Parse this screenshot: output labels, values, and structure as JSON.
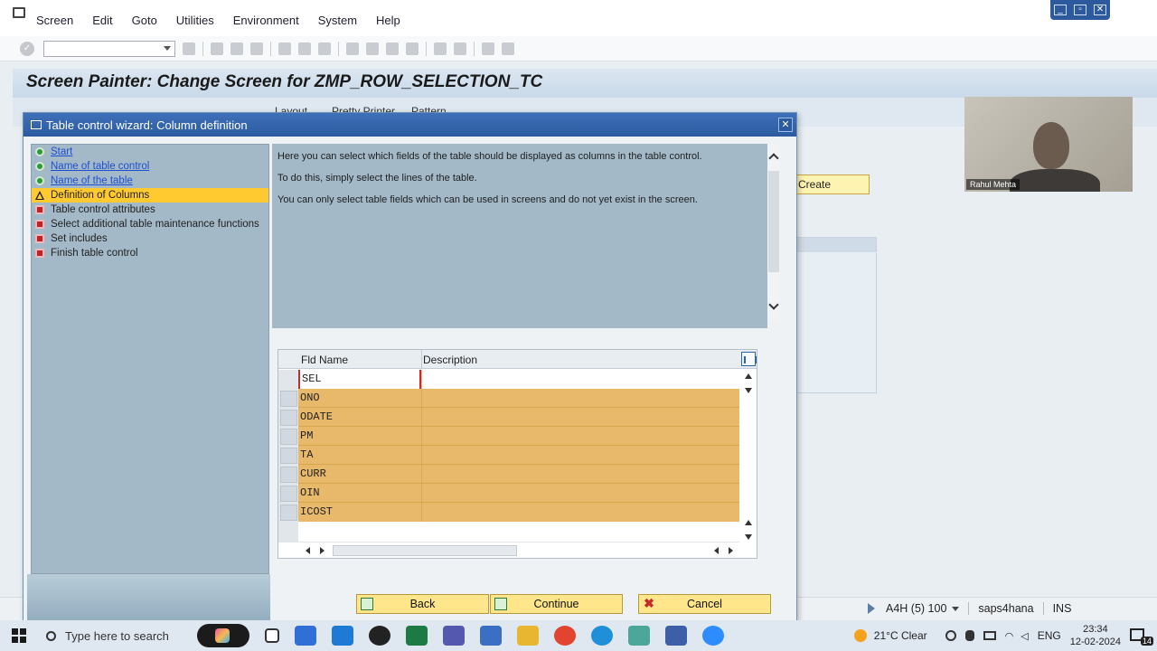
{
  "menu": [
    "Screen",
    "Edit",
    "Goto",
    "Utilities",
    "Environment",
    "System",
    "Help"
  ],
  "title": "Screen Painter: Change Screen for ZMP_ROW_SELECTION_TC",
  "subtoolbar": {
    "layout": "Layout",
    "pretty_printer": "Pretty Printer",
    "pattern": "Pattern"
  },
  "background": {
    "create_button": "Create"
  },
  "webcam": {
    "name": "Rahul Mehta"
  },
  "dialog": {
    "title": "Table control wizard: Column definition",
    "steps": [
      {
        "label": "Start",
        "state": "done"
      },
      {
        "label": "Name of table control",
        "state": "done"
      },
      {
        "label": "Name of the table",
        "state": "done"
      },
      {
        "label": "Definition of Columns",
        "state": "current"
      },
      {
        "label": "Table control attributes",
        "state": "todo"
      },
      {
        "label": "Select additional table maintenance functions",
        "state": "todo"
      },
      {
        "label": "Set includes",
        "state": "todo"
      },
      {
        "label": "Finish table control",
        "state": "todo"
      }
    ],
    "info": [
      "Here you can select which fields of the table should be displayed as columns in the table control.",
      "To do this, simply select the lines of the table.",
      "You can only select table fields which can be used in screens and do not yet exist in the screen."
    ],
    "table": {
      "headers": {
        "field": "Fld Name",
        "description": "Description"
      },
      "rows": [
        {
          "field": "SEL",
          "description": "",
          "selected": false
        },
        {
          "field": "ONO",
          "description": "",
          "selected": true
        },
        {
          "field": "ODATE",
          "description": "",
          "selected": true
        },
        {
          "field": "PM",
          "description": "",
          "selected": true
        },
        {
          "field": "TA",
          "description": "",
          "selected": true
        },
        {
          "field": "CURR",
          "description": "",
          "selected": true
        },
        {
          "field": "OIN",
          "description": "",
          "selected": true
        },
        {
          "field": "ICOST",
          "description": "",
          "selected": true
        }
      ]
    },
    "buttons": {
      "back": "Back",
      "continue": "Continue",
      "cancel": "Cancel"
    }
  },
  "status": {
    "system": "A4H (5) 100",
    "server": "saps4hana",
    "mode": "INS"
  },
  "taskbar": {
    "search_placeholder": "Type here to search",
    "weather": "21°C  Clear",
    "lang": "ENG",
    "time": "23:34",
    "date": "12-02-2024",
    "notifications": "14"
  },
  "colors": {
    "selected_row": "#e8b86b",
    "dialog_title": "#2b5aa0",
    "button": "#ffe68a",
    "active_step": "#ffc930"
  }
}
